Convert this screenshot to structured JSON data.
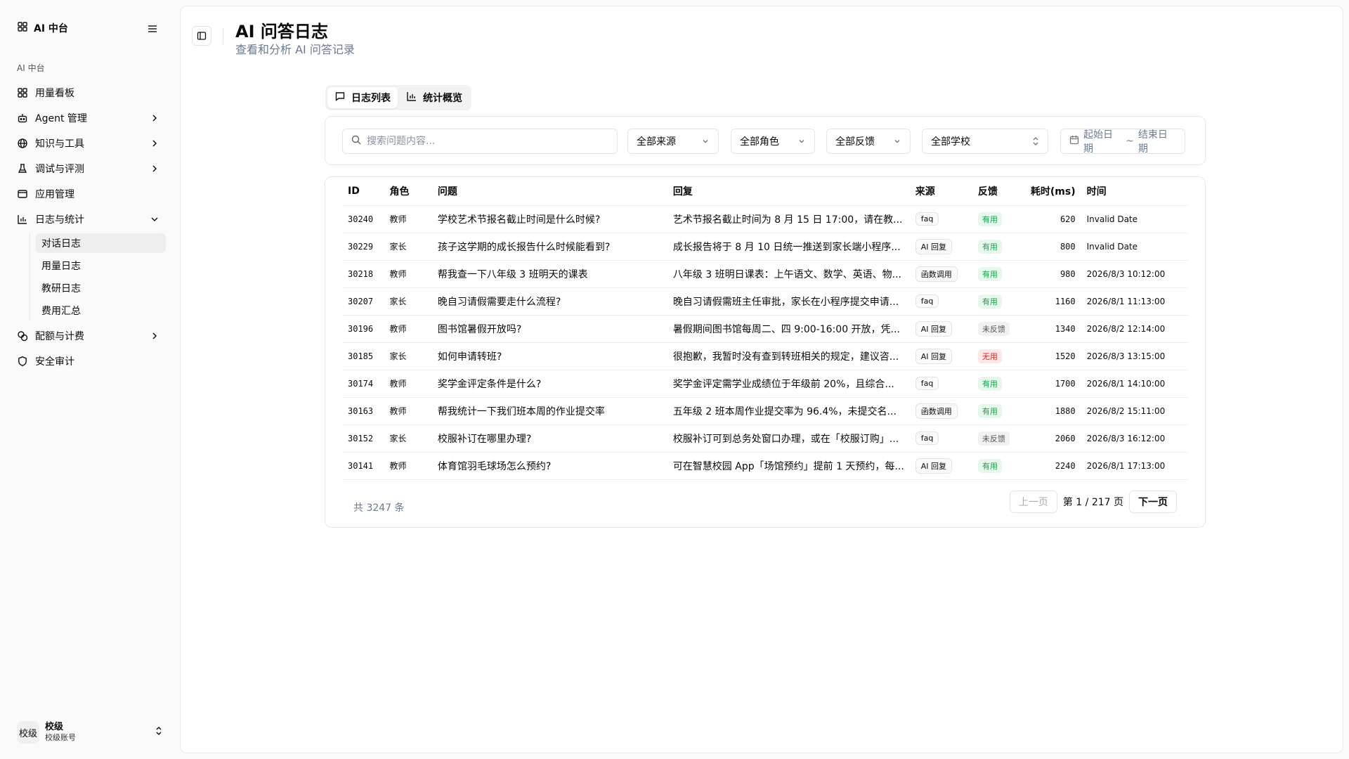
{
  "app": {
    "brand": "AI 中台"
  },
  "sidebar": {
    "group_label": "AI 中台",
    "items": [
      {
        "label": "用量看板",
        "icon": "grid-icon"
      },
      {
        "label": "Agent 管理",
        "icon": "bot-icon"
      },
      {
        "label": "知识与工具",
        "icon": "globe-icon"
      },
      {
        "label": "调试与评测",
        "icon": "flask-icon"
      },
      {
        "label": "应用管理",
        "icon": "window-icon"
      },
      {
        "label": "日志与统计",
        "icon": "bar-chart-icon"
      },
      {
        "label": "配额与计费",
        "icon": "coins-icon"
      },
      {
        "label": "安全审计",
        "icon": "shield-icon"
      }
    ],
    "sub_items": [
      "对话日志",
      "用量日志",
      "教研日志",
      "费用汇总"
    ],
    "user": {
      "avatar": "校级",
      "name": "校级",
      "sub": "校级账号"
    }
  },
  "header": {
    "title": "AI 问答日志",
    "subtitle": "查看和分析 AI 问答记录"
  },
  "tabs": [
    {
      "label": "日志列表"
    },
    {
      "label": "统计概览"
    }
  ],
  "filters": {
    "search_placeholder": "搜索问题内容...",
    "source": "全部来源",
    "role": "全部角色",
    "feedback": "全部反馈",
    "school": "全部学校",
    "date_start": "起始日期",
    "date_sep": "~",
    "date_end": "结束日期"
  },
  "table": {
    "columns": [
      "ID",
      "角色",
      "问题",
      "回复",
      "来源",
      "反馈",
      "耗时(ms)",
      "时间"
    ],
    "rows": [
      {
        "id": "30240",
        "role": "教师",
        "question": "学校艺术节报名截止时间是什么时候?",
        "answer": "艺术节报名截止时间为 8 月 15 日 17:00，请在教...",
        "source": "faq",
        "feedback": "有用",
        "ms": "620",
        "time": "Invalid Date"
      },
      {
        "id": "30229",
        "role": "家长",
        "question": "孩子这学期的成长报告什么时候能看到?",
        "answer": "成长报告将于 8 月 10 日统一推送到家长端小程序...",
        "source": "AI 回复",
        "feedback": "有用",
        "ms": "800",
        "time": "Invalid Date"
      },
      {
        "id": "30218",
        "role": "教师",
        "question": "帮我查一下八年级 3 班明天的课表",
        "answer": "八年级 3 班明日课表：上午语文、数学、英语、物...",
        "source": "函数调用",
        "feedback": "有用",
        "ms": "980",
        "time": "2026/8/3 10:12:00"
      },
      {
        "id": "30207",
        "role": "家长",
        "question": "晚自习请假需要走什么流程?",
        "answer": "晚自习请假需班主任审批，家长在小程序提交申请...",
        "source": "faq",
        "feedback": "有用",
        "ms": "1160",
        "time": "2026/8/1 11:13:00"
      },
      {
        "id": "30196",
        "role": "教师",
        "question": "图书馆暑假开放吗?",
        "answer": "暑假期间图书馆每周二、四 9:00-16:00 开放，凭...",
        "source": "AI 回复",
        "feedback": "未反馈",
        "ms": "1340",
        "time": "2026/8/2 12:14:00"
      },
      {
        "id": "30185",
        "role": "家长",
        "question": "如何申请转班?",
        "answer": "很抱歉，我暂时没有查到转班相关的规定，建议咨...",
        "source": "AI 回复",
        "feedback": "无用",
        "ms": "1520",
        "time": "2026/8/3 13:15:00"
      },
      {
        "id": "30174",
        "role": "教师",
        "question": "奖学金评定条件是什么?",
        "answer": "奖学金评定需学业成绩位于年级前 20%，且综合...",
        "source": "faq",
        "feedback": "有用",
        "ms": "1700",
        "time": "2026/8/1 14:10:00"
      },
      {
        "id": "30163",
        "role": "教师",
        "question": "帮我统计一下我们班本周的作业提交率",
        "answer": "五年级 2 班本周作业提交率为 96.4%，未提交名...",
        "source": "函数调用",
        "feedback": "有用",
        "ms": "1880",
        "time": "2026/8/2 15:11:00"
      },
      {
        "id": "30152",
        "role": "家长",
        "question": "校服补订在哪里办理?",
        "answer": "校服补订可到总务处窗口办理，或在「校服订购」...",
        "source": "faq",
        "feedback": "未反馈",
        "ms": "2060",
        "time": "2026/8/3 16:12:00"
      },
      {
        "id": "30141",
        "role": "教师",
        "question": "体育馆羽毛球场怎么预约?",
        "answer": "可在智慧校园 App「场馆预约」提前 1 天预约，每...",
        "source": "AI 回复",
        "feedback": "有用",
        "ms": "2240",
        "time": "2026/8/1 17:13:00"
      }
    ]
  },
  "pagination": {
    "total": "共 3247 条",
    "prev": "上一页",
    "info": "第 1 / 217 页",
    "next": "下一页"
  },
  "colors": {
    "useful": "#16a34a",
    "useless": "#dc2626",
    "muted": "#6b7a90"
  }
}
